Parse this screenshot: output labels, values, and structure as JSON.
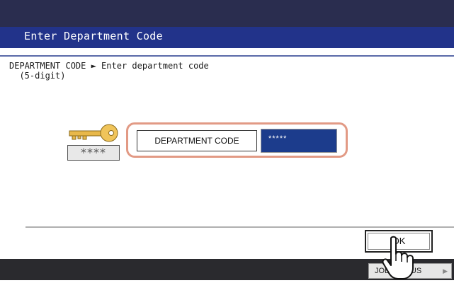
{
  "header": {
    "title": "Enter Department Code"
  },
  "instruction": {
    "text": "DEPARTMENT CODE ► Enter department code\n  (5-digit)"
  },
  "mask_icon": {
    "text": "****"
  },
  "department": {
    "label": "DEPARTMENT CODE",
    "value": "*****"
  },
  "ok_button": {
    "label": "OK"
  },
  "job_status": {
    "label": "JOB STATUS"
  },
  "colors": {
    "title_bar": "#22338a",
    "value_field": "#1c3c8c",
    "highlight": "#e29a85",
    "bottom_bar": "#2a2a2e"
  }
}
